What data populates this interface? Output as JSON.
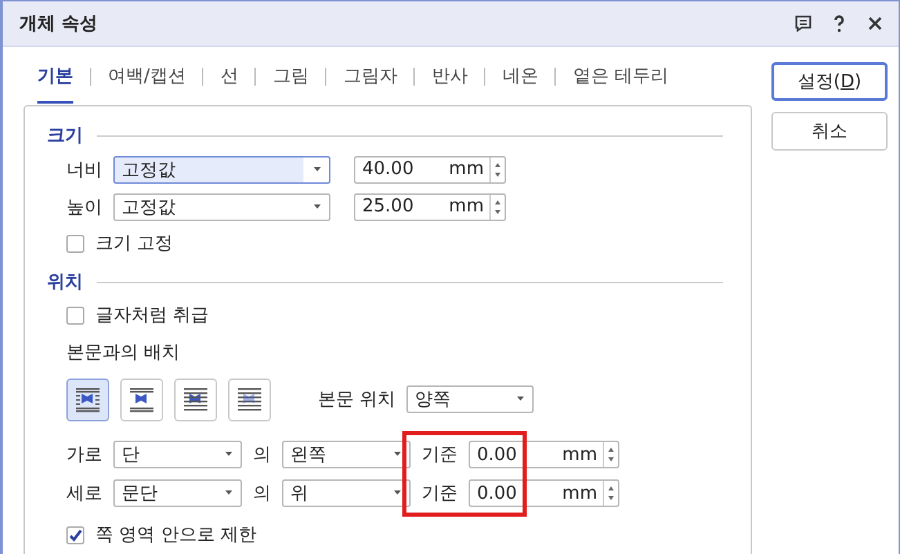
{
  "window": {
    "title": "개체 속성"
  },
  "tabs": [
    {
      "label": "기본",
      "selected": true
    },
    {
      "label": "여백/캡션",
      "selected": false
    },
    {
      "label": "선",
      "selected": false
    },
    {
      "label": "그림",
      "selected": false
    },
    {
      "label": "그림자",
      "selected": false
    },
    {
      "label": "반사",
      "selected": false
    },
    {
      "label": "네온",
      "selected": false
    },
    {
      "label": "옅은 테두리",
      "selected": false
    }
  ],
  "buttons": [
    {
      "before": "설정(",
      "access_key": "D",
      "after": ")",
      "default": true
    },
    {
      "before": "취소",
      "default": false
    }
  ],
  "size": {
    "title": "크기",
    "rows": [
      {
        "label": "너비",
        "mode": "고정값",
        "focused": true,
        "value": "40.00",
        "unit": "mm"
      },
      {
        "label": "높이",
        "mode": "고정값",
        "focused": false,
        "value": "25.00",
        "unit": "mm"
      }
    ],
    "lock": {
      "label": "크기 고정",
      "checked": false
    }
  },
  "position": {
    "title": "위치",
    "treat_as_char": {
      "label": "글자처럼 취급",
      "checked": false
    },
    "wrap_label": "본문과의 배치",
    "wrap_options": [
      {
        "kind": "square",
        "selected": true
      },
      {
        "kind": "top-bottom",
        "selected": false
      },
      {
        "kind": "behind",
        "selected": false
      },
      {
        "kind": "front",
        "selected": false
      }
    ],
    "text_side_label": "본문 위치",
    "text_side": "양쪽",
    "rows": [
      {
        "label": "가로",
        "ref": "단",
        "of": "의",
        "side": "왼쪽",
        "base": "기준",
        "value": "0.00",
        "unit": "mm"
      },
      {
        "label": "세로",
        "ref": "문단",
        "of": "의",
        "side": "위",
        "base": "기준",
        "value": "0.00",
        "unit": "mm"
      }
    ],
    "limit": {
      "label": "쪽 영역 안으로 제한",
      "checked": true
    }
  }
}
